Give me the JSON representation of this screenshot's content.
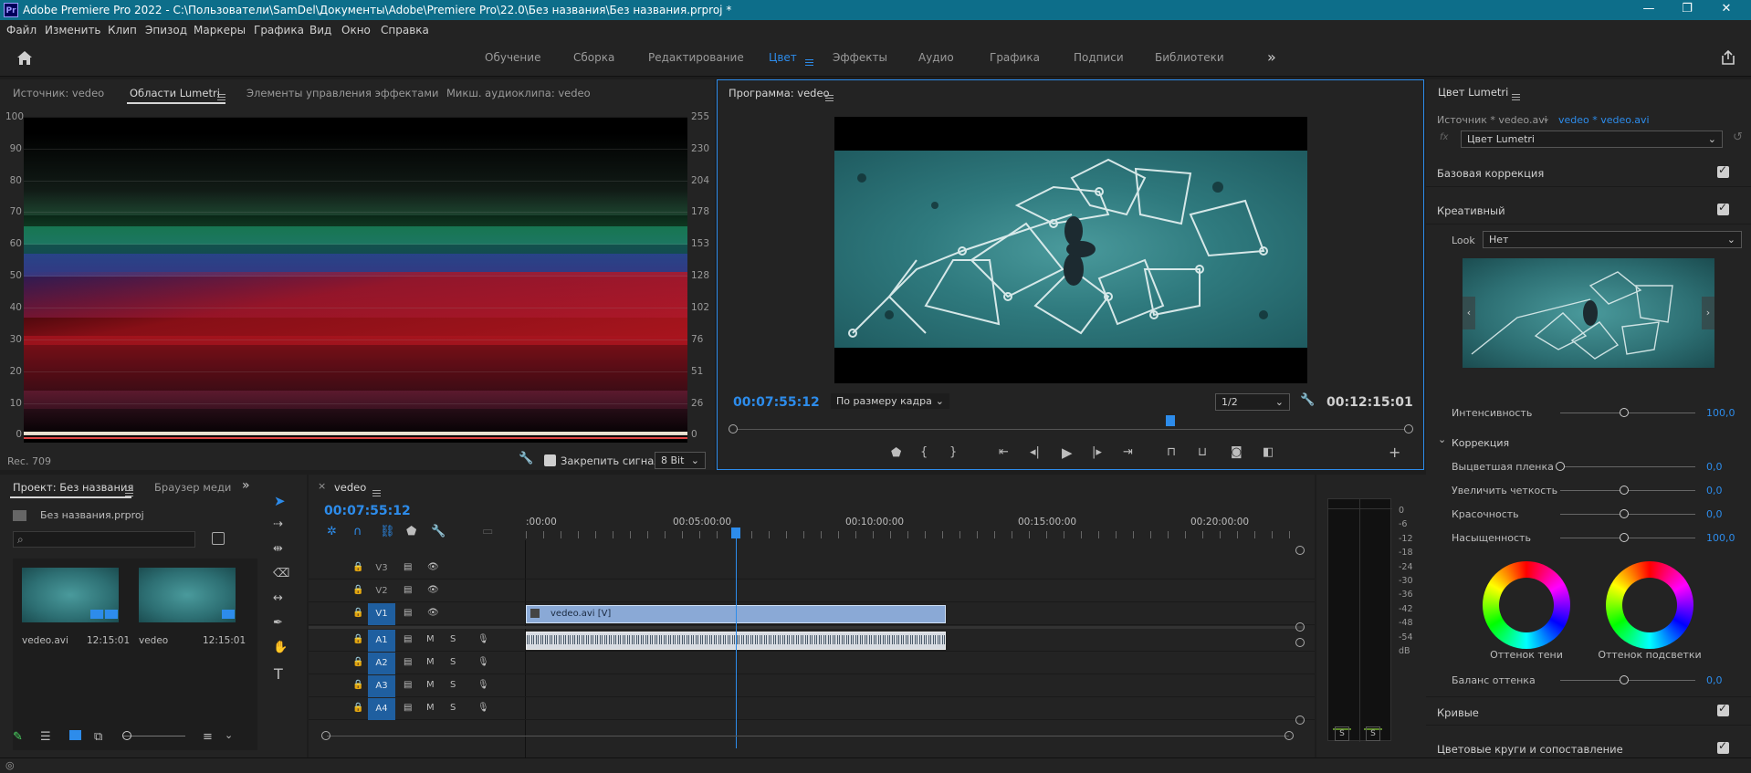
{
  "titlebar": {
    "app_icon": "Pr",
    "title": "Adobe Premiere Pro 2022 - C:\\Пользователи\\SamDel\\Документы\\Adobe\\Premiere Pro\\22.0\\Без названия\\Без названия.prproj *"
  },
  "menu": [
    "Файл",
    "Изменить",
    "Клип",
    "Эпизод",
    "Маркеры",
    "Графика",
    "Вид",
    "Окно",
    "Справка"
  ],
  "workspaces": [
    "Обучение",
    "Сборка",
    "Редактирование",
    "Цвет",
    "Эффекты",
    "Аудио",
    "Графика",
    "Подписи",
    "Библиотеки"
  ],
  "workspace_active": "Цвет",
  "source_panel": {
    "tabs": [
      "Источник: vedeo",
      "Области Lumetri",
      "Элементы управления эффектами",
      "Микш. аудиоклипа: vedeo"
    ],
    "scope_left_ticks": [
      "100",
      "90",
      "80",
      "70",
      "60",
      "50",
      "40",
      "30",
      "20",
      "10",
      "0"
    ],
    "scope_right_ticks": [
      "255",
      "230",
      "204",
      "178",
      "153",
      "128",
      "102",
      "76",
      "51",
      "26",
      "0"
    ],
    "colorspace": "Rec. 709",
    "clamp_label": "Закрепить сигнал",
    "bitdepth": "8 Bit"
  },
  "program": {
    "title": "Программа: vedeo",
    "timecode": "00:07:55:12",
    "fit": "По размеру кадра",
    "quality": "1/2",
    "duration": "00:12:15:01"
  },
  "lumetri": {
    "title": "Цвет Lumetri",
    "source": "Источник * vedeo.avi",
    "target": "vedeo * vedeo.avi",
    "fx": "Цвет Lumetri",
    "section_basic": "Базовая коррекция",
    "section_creative": "Креативный",
    "look_label": "Look",
    "look_value": "Нет",
    "intensity_label": "Интенсивность",
    "intensity_value": "100,0",
    "correction_label": "Коррекция",
    "sliders": [
      {
        "label": "Выцветшая пленка",
        "value": "0,0"
      },
      {
        "label": "Увеличить четкость",
        "value": "0,0"
      },
      {
        "label": "Красочность",
        "value": "0,0"
      },
      {
        "label": "Насыщенность",
        "value": "100,0"
      }
    ],
    "wheel_shadow": "Оттенок тени",
    "wheel_highlight": "Оттенок подсветки",
    "tint_balance_label": "Баланс оттенка",
    "tint_balance_value": "0,0",
    "section_curves": "Кривые",
    "section_wheels": "Цветовые круги и сопоставление"
  },
  "project": {
    "tabs": [
      "Проект: Без названия",
      "Браузер меди"
    ],
    "file": "Без названия.prproj",
    "items": [
      {
        "name": "vedeo.avi",
        "duration": "12:15:01"
      },
      {
        "name": "vedeo",
        "duration": "12:15:01"
      }
    ]
  },
  "timeline": {
    "tab": "vedeo",
    "timecode": "00:07:55:12",
    "ruler": [
      ":00:00",
      "00:05:00:00",
      "00:10:00:00",
      "00:15:00:00",
      "00:20:00:00"
    ],
    "video_tracks": [
      "V3",
      "V2",
      "V1"
    ],
    "audio_tracks": [
      "A1",
      "A2",
      "A3",
      "A4"
    ],
    "clip_label": "vedeo.avi [V]",
    "playhead_fraction": 0.3893
  },
  "meters": {
    "scale": [
      "0",
      "-6",
      "-12",
      "-18",
      "-24",
      "-30",
      "-36",
      "-42",
      "-48",
      "-54",
      "dB"
    ],
    "solo_labels": [
      "S",
      "S"
    ]
  },
  "colors": {
    "accent": "#2d8ceb",
    "titlebar": "#0d6e8a",
    "panel": "#232323"
  }
}
